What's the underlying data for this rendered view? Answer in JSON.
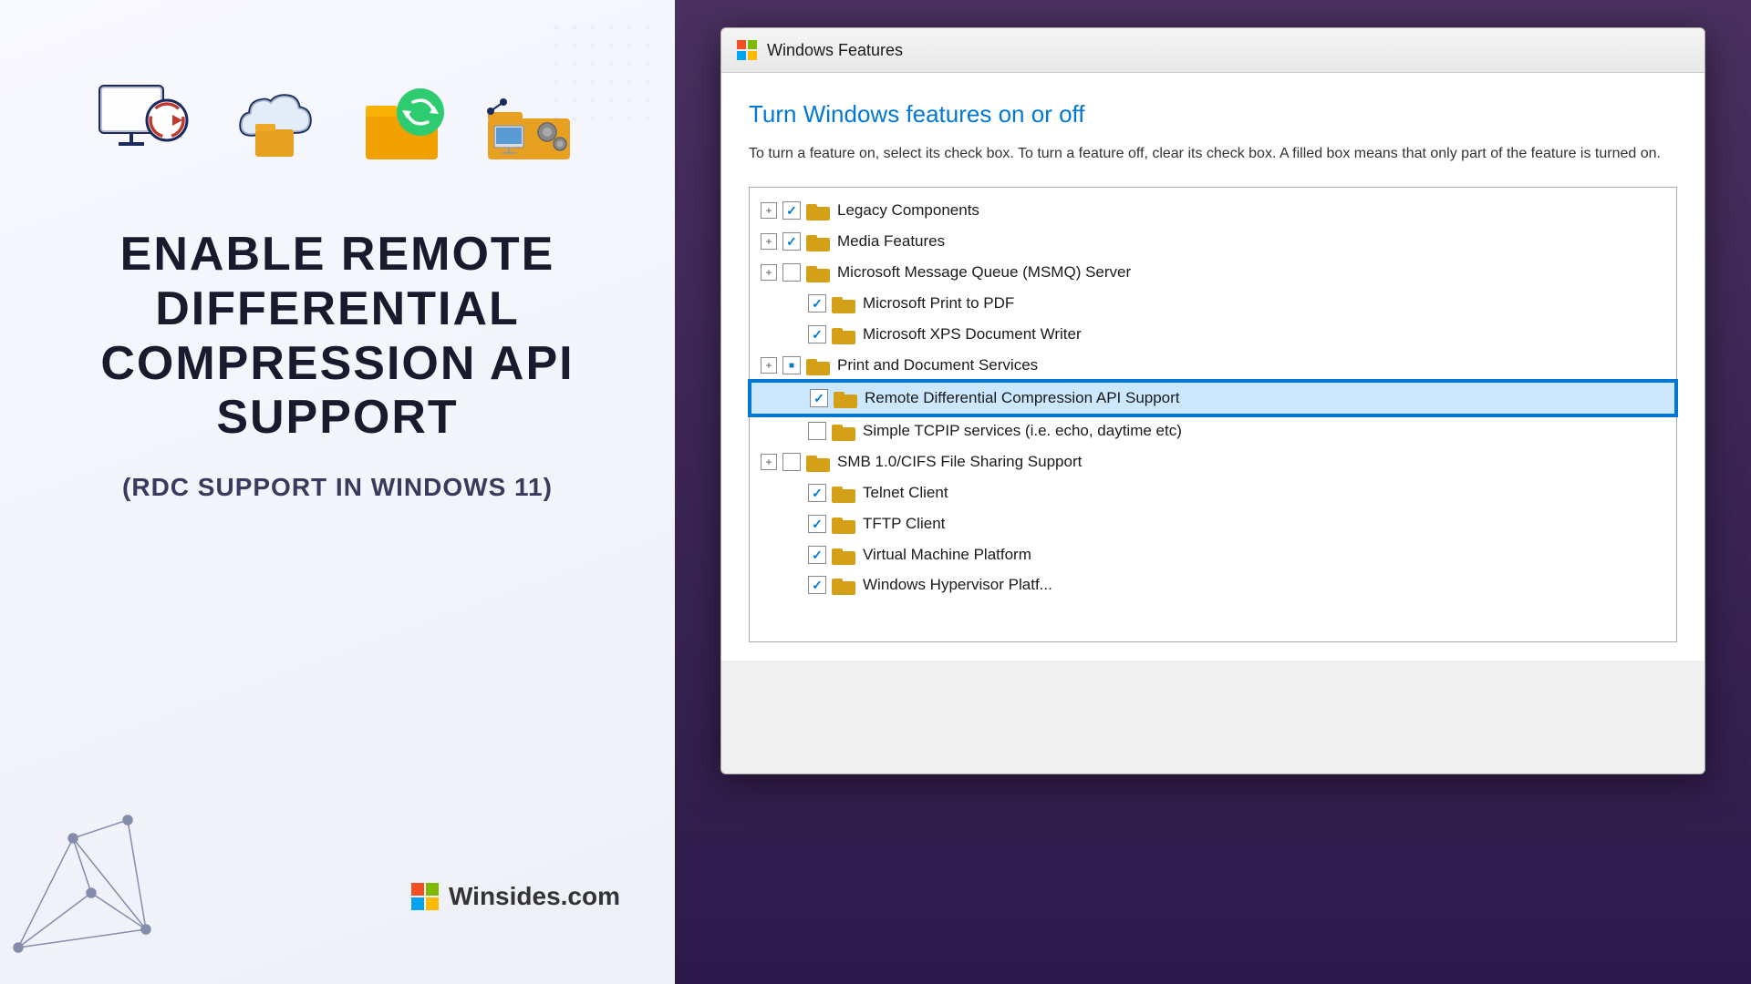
{
  "left": {
    "title_line1": "ENABLE REMOTE DIFFERENTIAL",
    "title_line2": "COMPRESSION API SUPPORT",
    "subtitle": "(RDC SUPPORT IN WINDOWS 11)",
    "brand": "Winsides.com"
  },
  "right": {
    "dialog_title": "Windows Features",
    "heading": "Turn Windows features on or off",
    "description": "To turn a feature on, select its check box. To turn a feature off, clear its check box. A filled box means that only part of the feature is turned on.",
    "features": [
      {
        "id": "legacy",
        "label": "Legacy Components",
        "hasExpand": true,
        "checkState": "checked",
        "hasFolder": true,
        "indent": 0
      },
      {
        "id": "media",
        "label": "Media Features",
        "hasExpand": true,
        "checkState": "checked",
        "hasFolder": true,
        "indent": 0
      },
      {
        "id": "msmq",
        "label": "Microsoft Message Queue (MSMQ) Server",
        "hasExpand": true,
        "checkState": "unchecked",
        "hasFolder": true,
        "indent": 0
      },
      {
        "id": "print-pdf",
        "label": "Microsoft Print to PDF",
        "hasExpand": false,
        "checkState": "checked",
        "hasFolder": true,
        "indent": 1
      },
      {
        "id": "xps",
        "label": "Microsoft XPS Document Writer",
        "hasExpand": false,
        "checkState": "checked",
        "hasFolder": true,
        "indent": 1
      },
      {
        "id": "print-doc",
        "label": "Print and Document Services",
        "hasExpand": true,
        "checkState": "partial",
        "hasFolder": true,
        "indent": 0
      },
      {
        "id": "rdc",
        "label": "Remote Differential Compression API Support",
        "hasExpand": false,
        "checkState": "checked",
        "hasFolder": true,
        "indent": 1,
        "highlighted": true
      },
      {
        "id": "tcpip",
        "label": "Simple TCPIP services (i.e. echo, daytime etc)",
        "hasExpand": false,
        "checkState": "unchecked",
        "hasFolder": true,
        "indent": 1
      },
      {
        "id": "smb",
        "label": "SMB 1.0/CIFS File Sharing Support",
        "hasExpand": true,
        "checkState": "unchecked",
        "hasFolder": true,
        "indent": 0
      },
      {
        "id": "telnet",
        "label": "Telnet Client",
        "hasExpand": false,
        "checkState": "checked",
        "hasFolder": true,
        "indent": 1
      },
      {
        "id": "tftp",
        "label": "TFTP Client",
        "hasExpand": false,
        "checkState": "checked",
        "hasFolder": true,
        "indent": 1
      },
      {
        "id": "vmp",
        "label": "Virtual Machine Platform",
        "hasExpand": false,
        "checkState": "checked",
        "hasFolder": true,
        "indent": 1
      },
      {
        "id": "wsl",
        "label": "Windows Hypervisor Platf...",
        "hasExpand": false,
        "checkState": "checked",
        "hasFolder": true,
        "indent": 1
      }
    ]
  }
}
